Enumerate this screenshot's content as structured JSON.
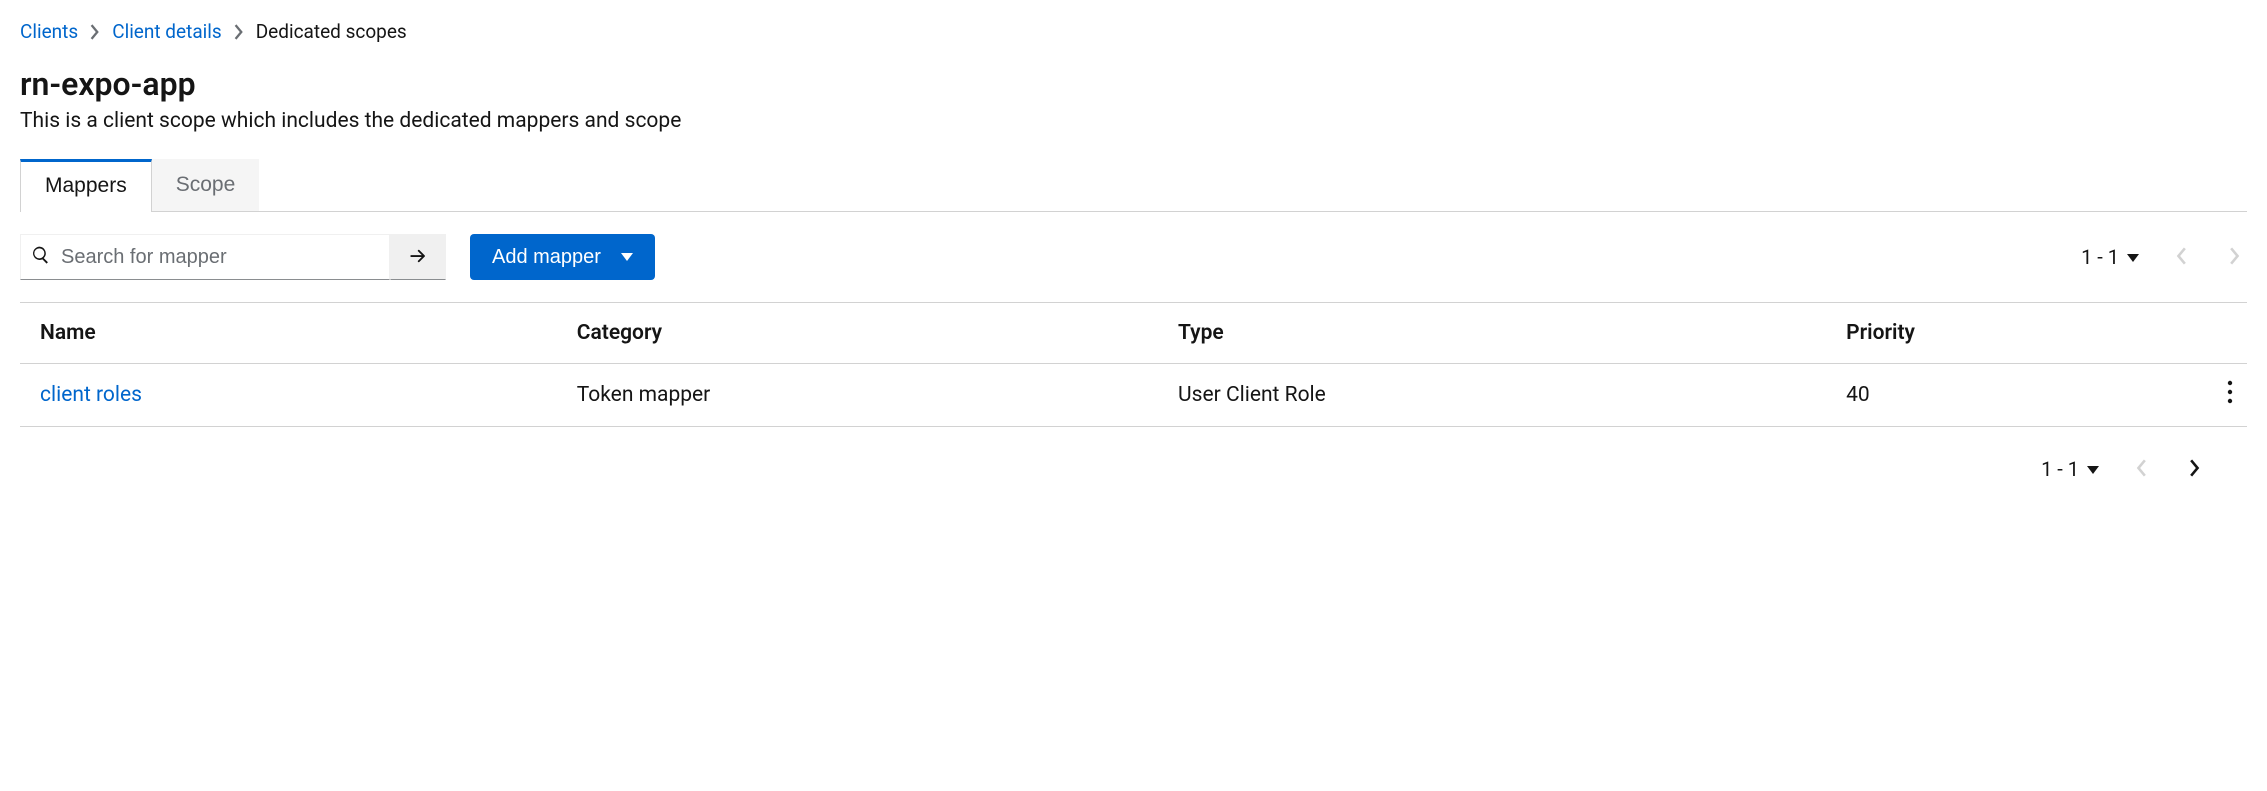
{
  "breadcrumb": {
    "items": [
      {
        "label": "Clients",
        "link": true
      },
      {
        "label": "Client details",
        "link": true
      },
      {
        "label": "Dedicated scopes",
        "link": false
      }
    ]
  },
  "page": {
    "title": "rn-expo-app",
    "description": "This is a client scope which includes the dedicated mappers and scope"
  },
  "tabs": {
    "items": [
      {
        "label": "Mappers",
        "active": true
      },
      {
        "label": "Scope",
        "active": false
      }
    ]
  },
  "toolbar": {
    "search_placeholder": "Search for mapper",
    "add_mapper_label": "Add mapper"
  },
  "pagination": {
    "range_label": "1 - 1"
  },
  "table": {
    "columns": {
      "name": "Name",
      "category": "Category",
      "type": "Type",
      "priority": "Priority"
    },
    "rows": [
      {
        "name": "client roles",
        "category": "Token mapper",
        "type": "User Client Role",
        "priority": "40"
      }
    ]
  }
}
